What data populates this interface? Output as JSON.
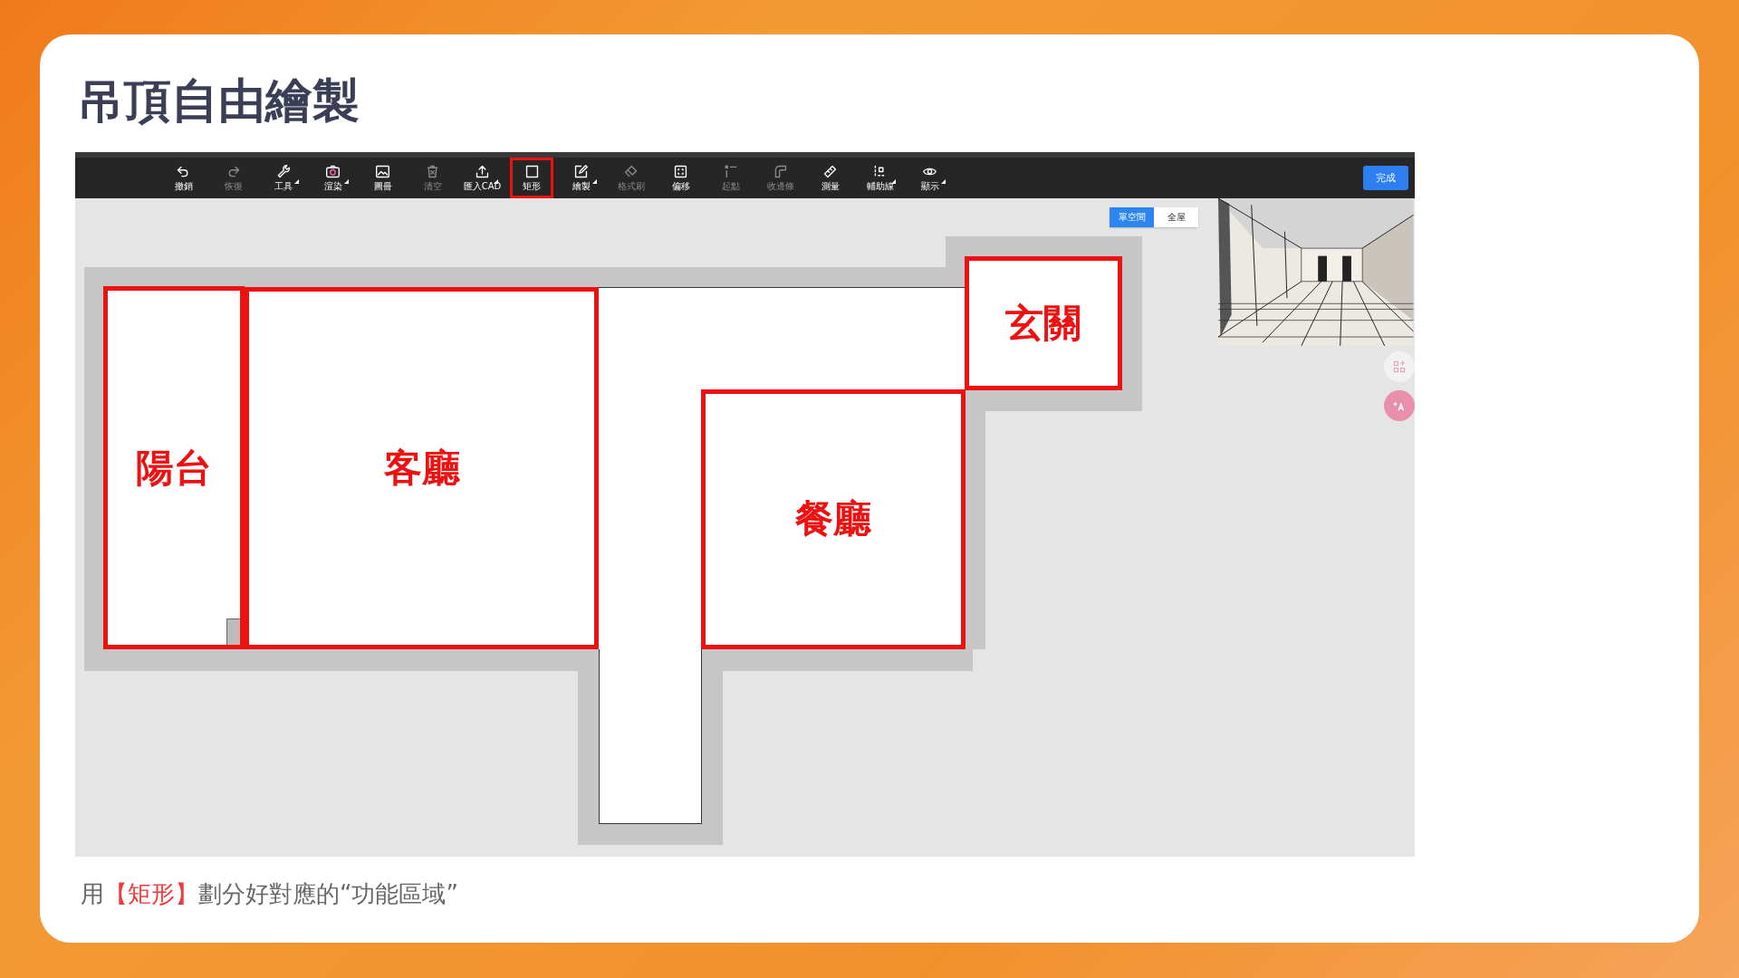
{
  "slide": {
    "title": "吊頂自由繪製"
  },
  "toolbar": {
    "tools": [
      {
        "label": "撤銷",
        "disabled": false,
        "selected": false,
        "has_menu": false
      },
      {
        "label": "恢復",
        "disabled": true,
        "selected": false,
        "has_menu": false
      },
      {
        "label": "工具",
        "disabled": false,
        "selected": false,
        "has_menu": true
      },
      {
        "label": "渲染",
        "disabled": false,
        "selected": false,
        "has_menu": true
      },
      {
        "label": "圖冊",
        "disabled": false,
        "selected": false,
        "has_menu": false
      },
      {
        "label": "清空",
        "disabled": true,
        "selected": false,
        "has_menu": false
      },
      {
        "label": "匯入CAD",
        "disabled": false,
        "selected": false,
        "has_menu": true
      },
      {
        "label": "矩形",
        "disabled": false,
        "selected": true,
        "has_menu": false
      },
      {
        "label": "繪製",
        "disabled": false,
        "selected": false,
        "has_menu": true
      },
      {
        "label": "格式刷",
        "disabled": true,
        "selected": false,
        "has_menu": false
      },
      {
        "label": "偏移",
        "disabled": false,
        "selected": false,
        "has_menu": false
      },
      {
        "label": "起點",
        "disabled": true,
        "selected": false,
        "has_menu": false
      },
      {
        "label": "收邊條",
        "disabled": true,
        "selected": false,
        "has_menu": false
      },
      {
        "label": "測量",
        "disabled": false,
        "selected": false,
        "has_menu": false
      },
      {
        "label": "輔助線",
        "disabled": false,
        "selected": false,
        "has_menu": true
      },
      {
        "label": "顯示",
        "disabled": false,
        "selected": false,
        "has_menu": true
      }
    ],
    "done_button": "完成"
  },
  "view_toggle": [
    {
      "label": "單空間",
      "selected": true
    },
    {
      "label": "全屋",
      "selected": false
    }
  ],
  "rooms": [
    {
      "label": "陽台"
    },
    {
      "label": "客廳"
    },
    {
      "label": "玄關"
    },
    {
      "label": "餐廳"
    }
  ],
  "caption": [
    {
      "text": "用",
      "highlight": false
    },
    {
      "text": "【矩形】",
      "highlight": true
    },
    {
      "text": "劃分好對應的“功能區域”",
      "highlight": false
    }
  ]
}
